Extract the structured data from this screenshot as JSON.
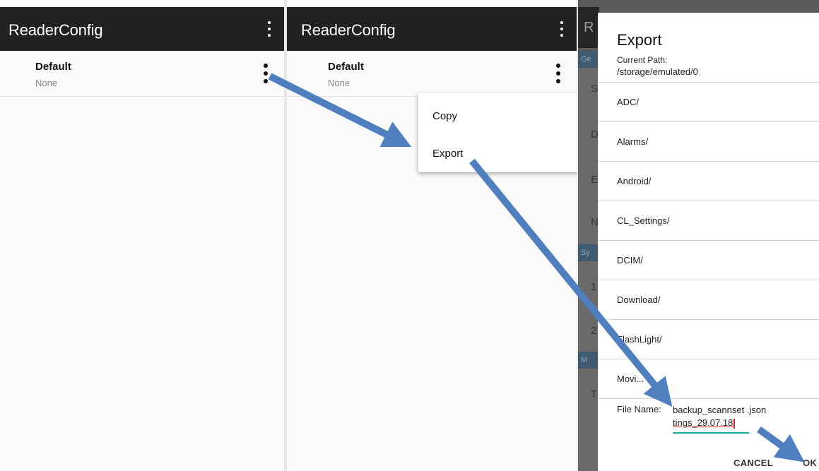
{
  "panel1": {
    "app_title": "ReaderConfig",
    "row": {
      "name": "Default",
      "sub": "None"
    }
  },
  "panel2": {
    "app_title": "ReaderConfig",
    "row": {
      "name": "Default",
      "sub": "None"
    },
    "popup_menu": {
      "copy": "Copy",
      "export": "Export"
    }
  },
  "panel3": {
    "background_letters": [
      "R",
      "Ge",
      "S",
      "D",
      "E",
      "N",
      "Sy",
      "1",
      "2",
      "M",
      "T"
    ],
    "dialog": {
      "title": "Export",
      "path_label": "Current Path:",
      "path": "/storage/emulated/0",
      "directories": [
        "ADC/",
        "Alarms/",
        "Android/",
        "CL_Settings/",
        "DCIM/",
        "Download/",
        "FlashLight/",
        "Movi..."
      ],
      "filename_label": "File Name:",
      "filename_line1": "backup_scannset .json",
      "filename_line2": "tings_29.07.18",
      "cancel": "CANCEL",
      "ok": "OK"
    }
  },
  "arrow_color": "#4f7fbf"
}
